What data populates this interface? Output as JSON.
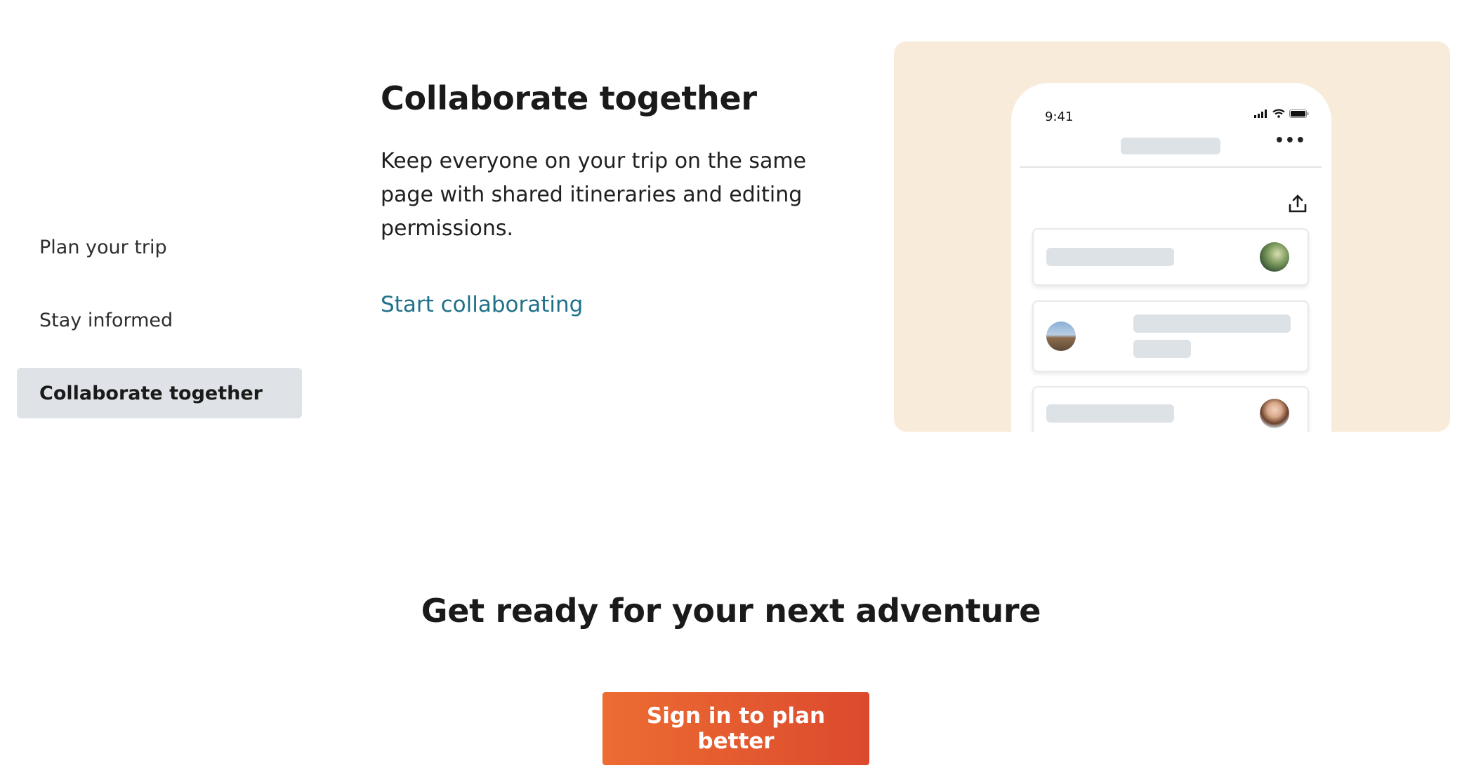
{
  "nav": {
    "items": [
      {
        "label": "Plan your trip",
        "active": false
      },
      {
        "label": "Stay informed",
        "active": false
      },
      {
        "label": "Collaborate together",
        "active": true
      }
    ]
  },
  "feature": {
    "title": "Collaborate together",
    "description": "Keep everyone on your trip on the same page with shared itineraries and editing permissions.",
    "link_label": "Start collaborating"
  },
  "phone": {
    "time": "9:41",
    "more_icon": "more-horizontal-icon",
    "share_icon": "share-upload-icon"
  },
  "cta": {
    "heading": "Get ready for your next adventure",
    "button_label": "Sign in to plan better"
  },
  "colors": {
    "illustration_bg": "#f9ebd9",
    "link": "#1f7189",
    "active_tab_bg": "#dfe3e7",
    "cta_gradient_start": "#ec6c32",
    "cta_gradient_end": "#dc4a2e"
  }
}
